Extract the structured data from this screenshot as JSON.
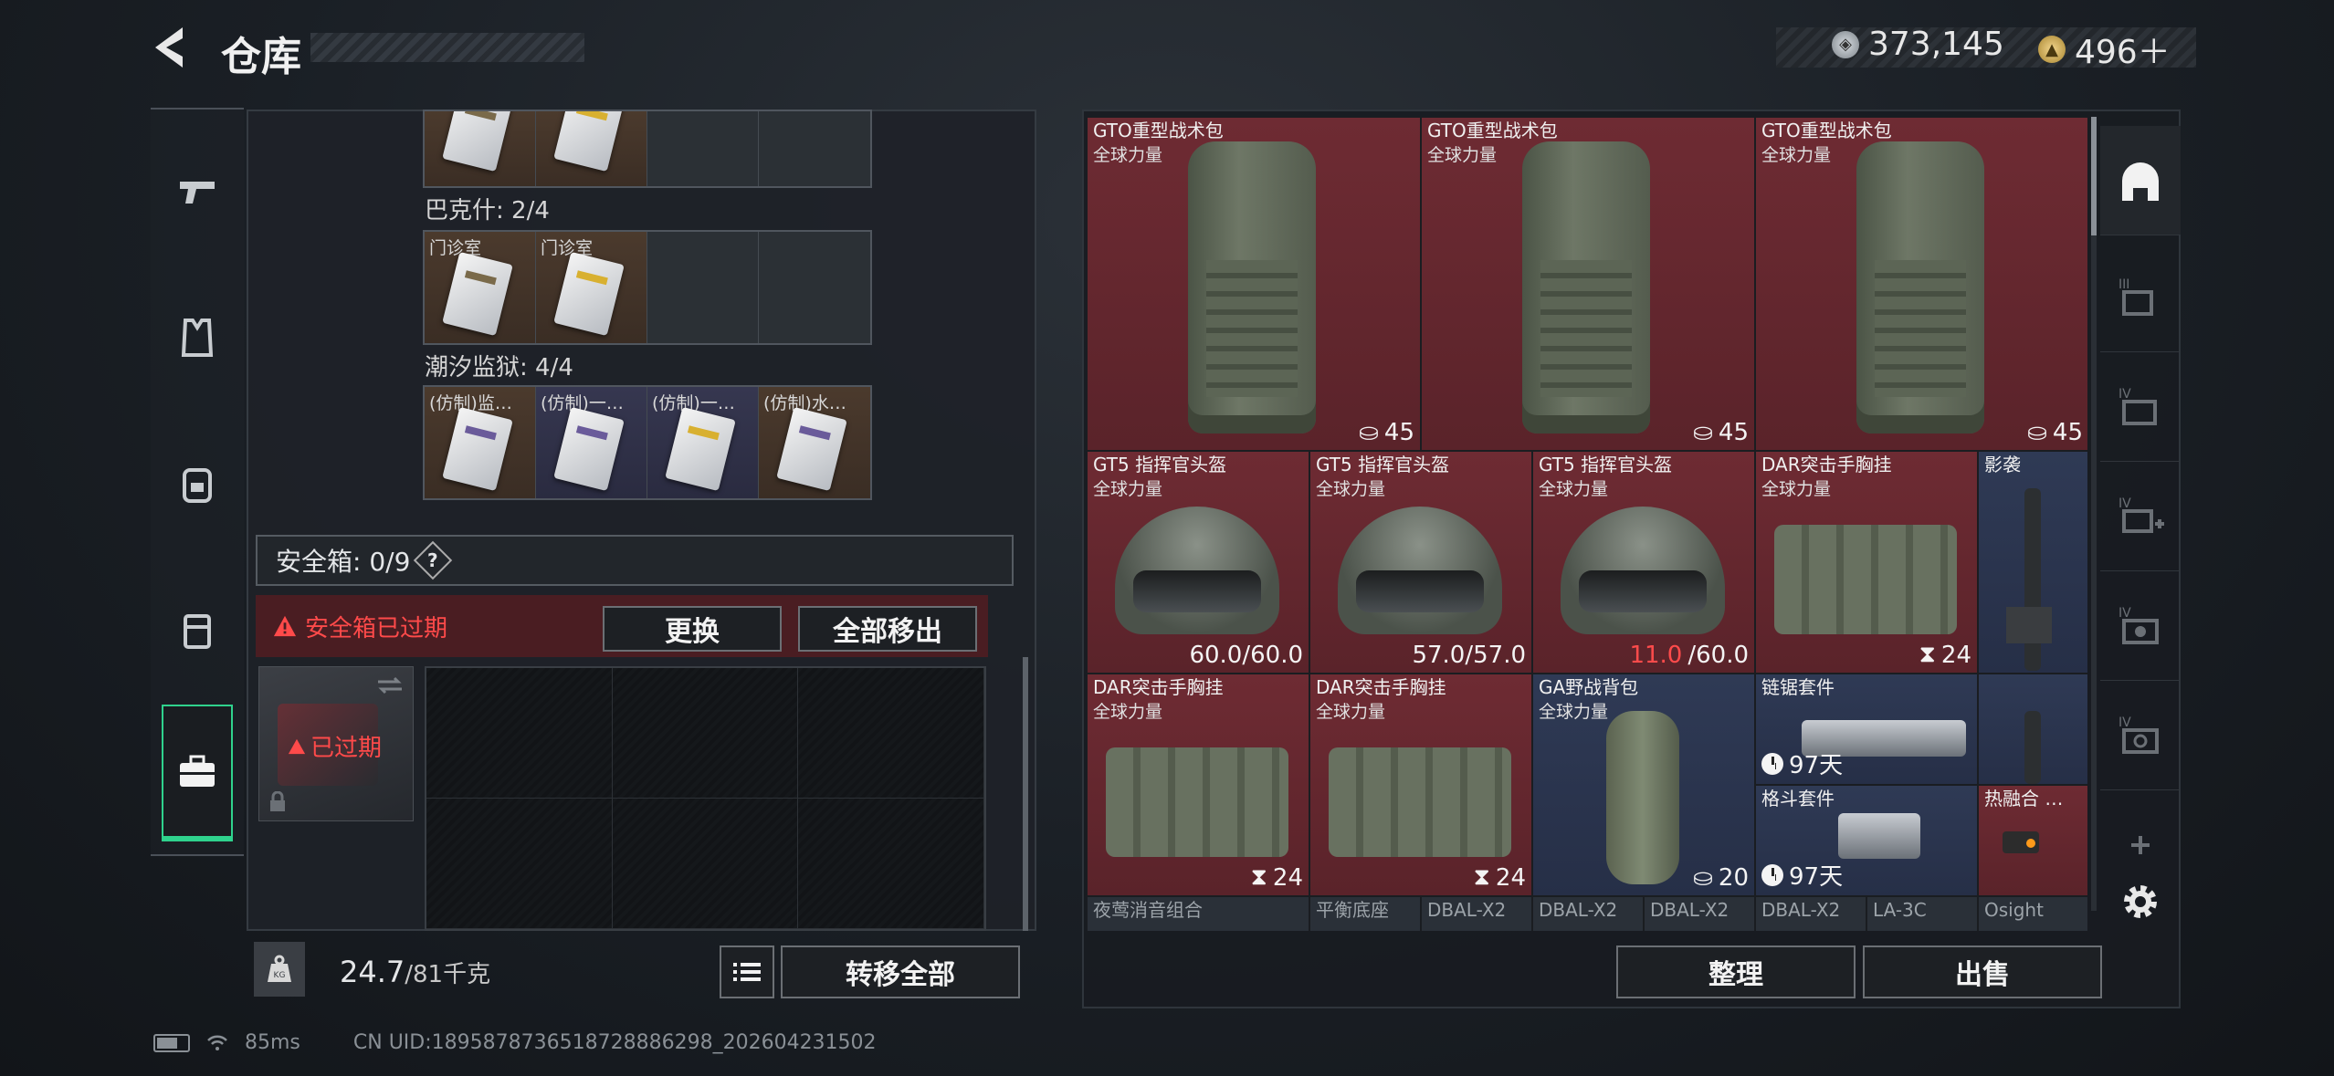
{
  "header": {
    "title": "仓库",
    "currency_silver": "373,145",
    "currency_gold": "496＋"
  },
  "left_rail": {
    "items": [
      "pistol-icon",
      "vest-icon",
      "backpack-icon",
      "pouch-icon",
      "toolbox-icon"
    ],
    "active": "toolbox-icon"
  },
  "container": {
    "sections": [
      {
        "label": "巴克什: 2/4",
        "cells": [
          "门诊室",
          "门诊室",
          "",
          ""
        ]
      },
      {
        "label": "潮汐监狱: 4/4",
        "cells": [
          "(仿制)监…",
          "(仿制)一…",
          "(仿制)一…",
          "(仿制)水…"
        ]
      }
    ],
    "safebox_label": "安全箱: 0/9",
    "help": "?",
    "expired_warning": "安全箱已过期",
    "replace_button": "更换",
    "remove_all_button": "全部移出",
    "safebox_status": "已过期",
    "weight_badge": "KG",
    "weight_value": "24.7",
    "weight_total": "/81千克",
    "transfer_all_button": "转移全部"
  },
  "stash": {
    "items": [
      {
        "name": "GTO重型战术包",
        "sub": "全球力量",
        "value": "45"
      },
      {
        "name": "GTO重型战术包",
        "sub": "全球力量",
        "value": "45"
      },
      {
        "name": "GTO重型战术包",
        "sub": "全球力量",
        "value": "45"
      },
      {
        "name": "GT5 指挥官头盔",
        "sub": "全球力量",
        "value": "60.0/60.0"
      },
      {
        "name": "GT5 指挥官头盔",
        "sub": "全球力量",
        "value": "57.0/57.0"
      },
      {
        "name": "GT5 指挥官头盔",
        "sub": "全球力量",
        "value_warn": "11.0",
        "value_rest": "/60.0"
      },
      {
        "name": "DAR突击手胸挂",
        "sub": "全球力量",
        "value": "24"
      },
      {
        "name": "影袭",
        "sub": "",
        "value": ""
      },
      {
        "name": "DAR突击手胸挂",
        "sub": "全球力量",
        "value": "24"
      },
      {
        "name": "DAR突击手胸挂",
        "sub": "全球力量",
        "value": "24"
      },
      {
        "name": "GA野战背包",
        "sub": "全球力量",
        "value": "20"
      },
      {
        "name": "链锯套件",
        "sub": "",
        "timer": "97天"
      },
      {
        "name": "格斗套件",
        "sub": "",
        "timer": "97天"
      },
      {
        "name": "热融合 …",
        "sub": "",
        "value": ""
      }
    ],
    "bottom_row": [
      "夜莺消音组合",
      "平衡底座",
      "DBAL-X2",
      "DBAL-X2",
      "DBAL-X2",
      "DBAL-X2",
      "LA-3C",
      "Osight"
    ],
    "sort_button": "整理",
    "sell_button": "出售"
  },
  "right_rail": {
    "items": [
      "stash-icon",
      "tier3-icon",
      "tier4-icon",
      "tier4-medkit-icon",
      "tier4-camera-icon",
      "tier4-gear-icon"
    ],
    "active": "stash-icon"
  },
  "status_bar": {
    "ping": "85ms",
    "uid": "CN UID:1895878736518728886298_202604231502"
  }
}
